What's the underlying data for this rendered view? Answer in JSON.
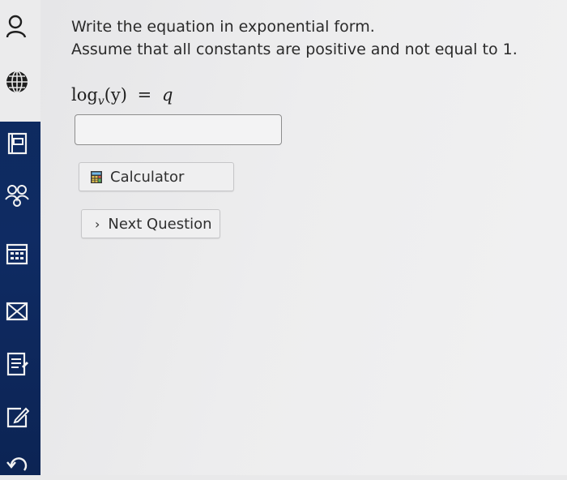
{
  "sidebar": {
    "items": [
      {
        "icon": "user-icon"
      },
      {
        "icon": "globe-icon"
      },
      {
        "icon": "book-icon"
      },
      {
        "icon": "people-icon"
      },
      {
        "icon": "calendar-icon"
      },
      {
        "icon": "mail-icon"
      },
      {
        "icon": "document-icon"
      },
      {
        "icon": "edit-icon"
      },
      {
        "icon": "back-icon"
      }
    ]
  },
  "question": {
    "line1": "Write the equation in exponential form.",
    "line2": "Assume that all constants are positive and not equal to 1."
  },
  "equation": {
    "func": "log",
    "base": "v",
    "arg": "(y)",
    "equals": "=",
    "rhs": "q"
  },
  "answer": {
    "value": ""
  },
  "buttons": {
    "calculator": "Calculator",
    "next": "Next Question",
    "next_icon": "›"
  },
  "colors": {
    "sidebar": "#0f2b63",
    "background": "#ececed"
  }
}
